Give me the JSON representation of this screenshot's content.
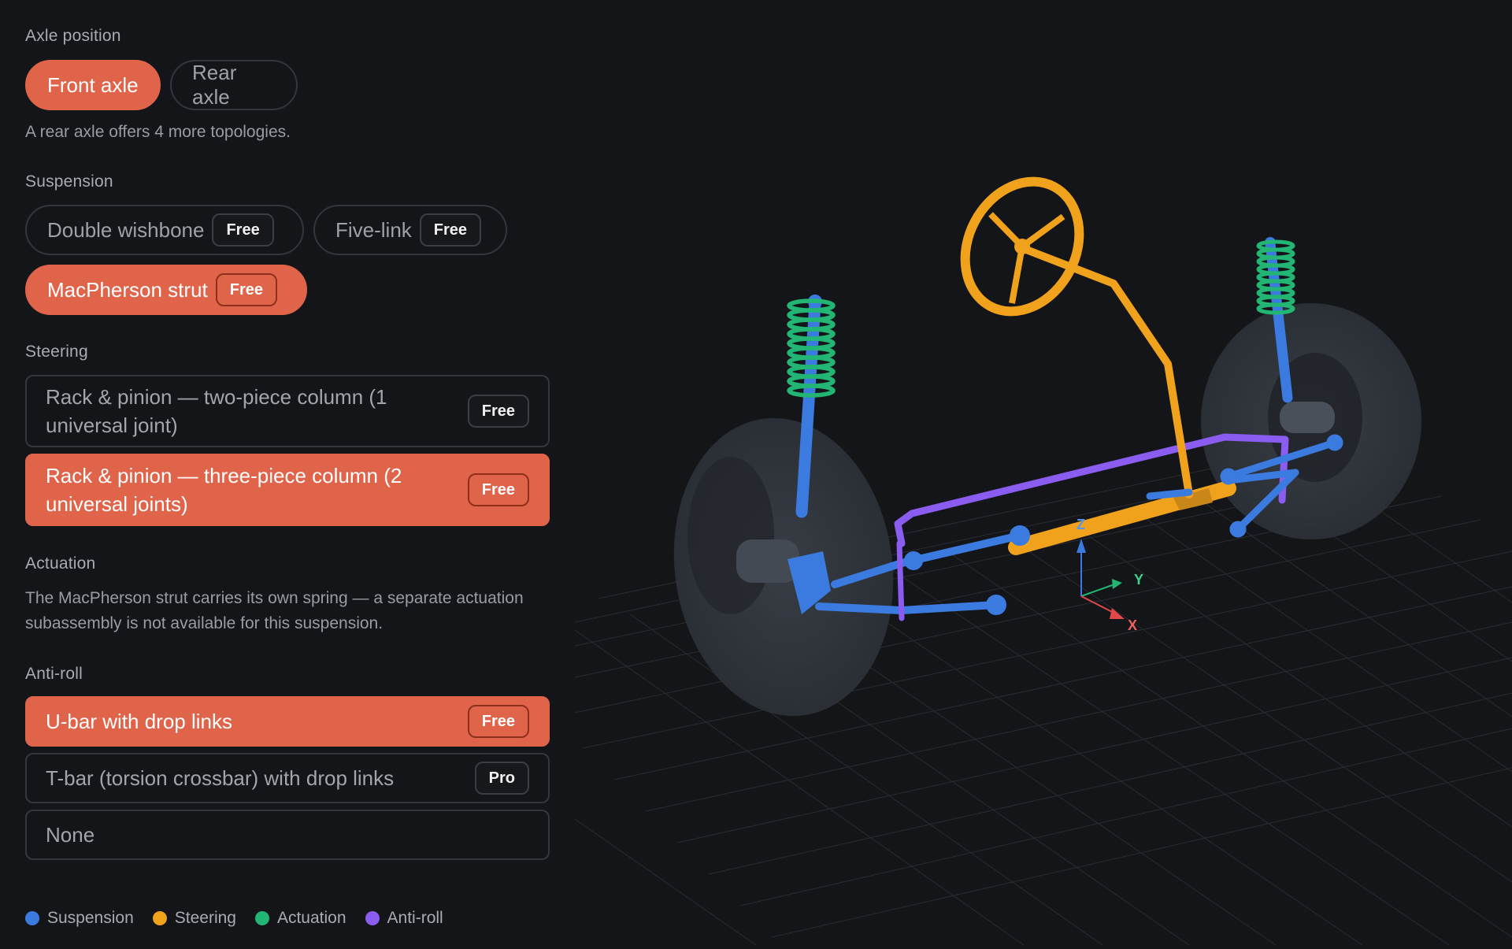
{
  "axle": {
    "label": "Axle position",
    "options": [
      "Front axle",
      "Rear axle"
    ],
    "hint": "A rear axle offers 4 more topologies."
  },
  "suspension": {
    "label": "Suspension",
    "options": [
      {
        "label": "Double wishbone",
        "badge": "Free"
      },
      {
        "label": "Five-link",
        "badge": "Free"
      },
      {
        "label": "MacPherson strut",
        "badge": "Free"
      }
    ]
  },
  "steering": {
    "label": "Steering",
    "options": [
      {
        "label": "Rack & pinion — two-piece column (1 universal joint)",
        "badge": "Free"
      },
      {
        "label": "Rack & pinion — three-piece column (2 universal joints)",
        "badge": "Free"
      }
    ]
  },
  "actuation": {
    "label": "Actuation",
    "hint": "The MacPherson strut carries its own spring — a separate actuation subassembly is not available for this suspension."
  },
  "antiroll": {
    "label": "Anti-roll",
    "options": [
      {
        "label": "U-bar with drop links",
        "badge": "Free"
      },
      {
        "label": "T-bar (torsion crossbar) with drop links",
        "badge": "Pro"
      },
      {
        "label": "None",
        "badge": ""
      }
    ]
  },
  "legend": [
    "Suspension",
    "Steering",
    "Actuation",
    "Anti-roll"
  ],
  "axes": {
    "x": "X",
    "y": "Y",
    "z": "Z"
  },
  "colors": {
    "accent": "#e0644a",
    "suspension": "#3b7be0",
    "steering": "#f0a21c",
    "actuation": "#22b574",
    "antiroll": "#8a5cf0"
  }
}
